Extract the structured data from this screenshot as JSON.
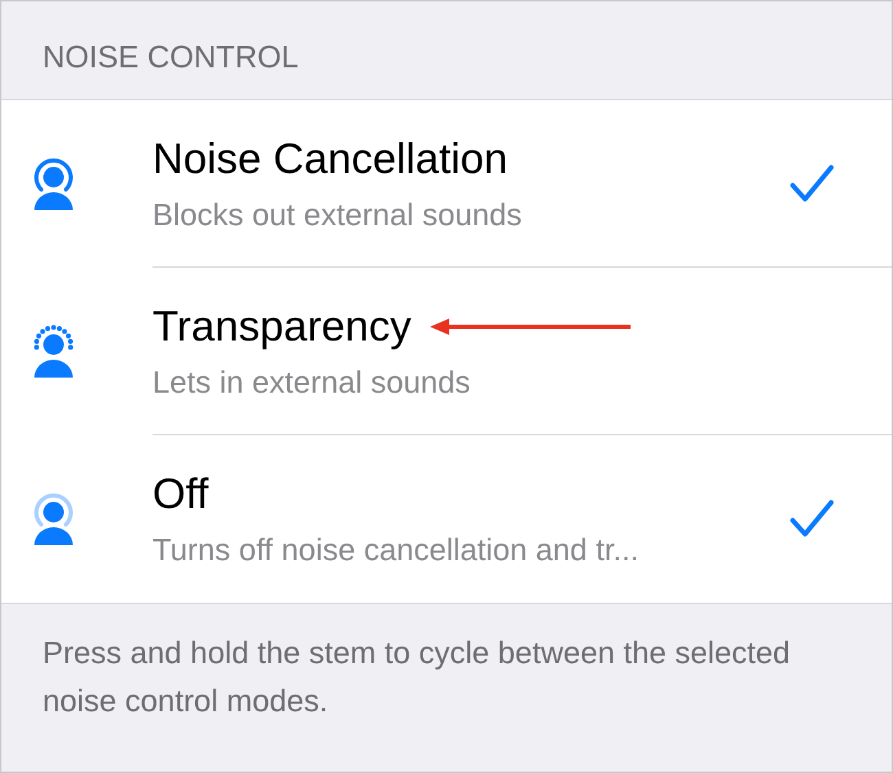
{
  "section_header": "NOISE CONTROL",
  "modes": [
    {
      "kind": "ring",
      "title": "Noise Cancellation",
      "subtitle": "Blocks out external sounds",
      "selected": true,
      "annotated": false
    },
    {
      "kind": "dotted",
      "title": "Transparency",
      "subtitle": "Lets in external sounds",
      "selected": false,
      "annotated": true
    },
    {
      "kind": "faint-ring",
      "title": "Off",
      "subtitle": "Turns off noise cancellation and tr...",
      "selected": true,
      "annotated": false
    }
  ],
  "footer": "Press and hold the stem to cycle between the selected noise control modes."
}
